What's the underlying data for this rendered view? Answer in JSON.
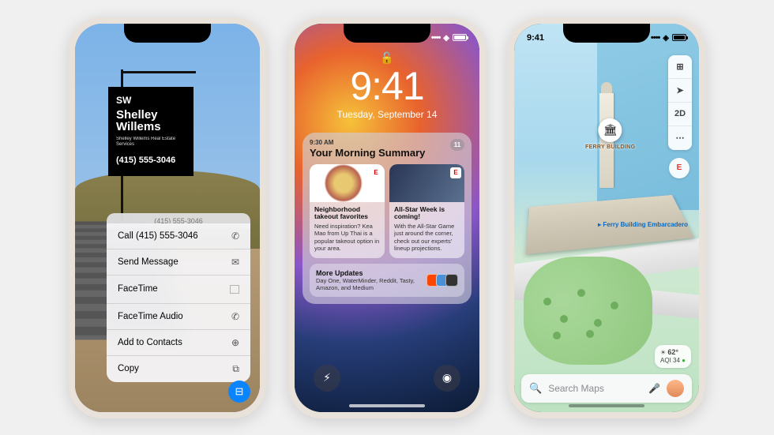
{
  "status": {
    "time": "9:41"
  },
  "phone1": {
    "sign": {
      "logo": "SW",
      "name": "Shelley Willems",
      "subtitle": "Shelley Willems\nReal Estate Services",
      "phone": "(415) 555-3046"
    },
    "context_header": "(415) 555-3046",
    "menu": [
      {
        "label": "Call (415) 555-3046",
        "icon": "phone"
      },
      {
        "label": "Send Message",
        "icon": "message"
      },
      {
        "label": "FaceTime",
        "icon": "video"
      },
      {
        "label": "FaceTime Audio",
        "icon": "phone"
      },
      {
        "label": "Add to Contacts",
        "icon": "contact"
      },
      {
        "label": "Copy",
        "icon": "copy"
      }
    ]
  },
  "phone2": {
    "lock_time": "9:41",
    "lock_date": "Tuesday, September 14",
    "summary": {
      "time_label": "9:30 AM",
      "title": "Your Morning Summary",
      "count": "11",
      "cards": [
        {
          "badge": "E",
          "title": "Neighborhood takeout favorites",
          "text": "Need inspiration? Kea Mao from Up Thai is a popular takeout option in your area."
        },
        {
          "badge": "E",
          "title": "All-Star Week is coming!",
          "text": "With the All-Star Game just around the corner, check out our experts' lineup projections."
        }
      ],
      "more": {
        "title": "More Updates",
        "text": "Day One, WaterMinder, Reddit, Tasty, Amazon, and Medium"
      }
    }
  },
  "phone3": {
    "controls": [
      "⊞",
      "➤",
      "2D",
      "⋯"
    ],
    "compass": "E",
    "pin_label": "FERRY BUILDING",
    "transit_label": "Ferry Building\nEmbarcadero",
    "weather": {
      "temp": "62°",
      "aqi": "AQI 34"
    },
    "search_placeholder": "Search Maps"
  },
  "icons": {
    "phone": "✆",
    "message": "✉",
    "video": "⃞",
    "contact": "⊕",
    "copy": "⧉",
    "lock": "🔓",
    "torch": "⚡︎",
    "camera": "◉",
    "mag": "🔍",
    "mic": "🎤",
    "sun": "☀"
  }
}
